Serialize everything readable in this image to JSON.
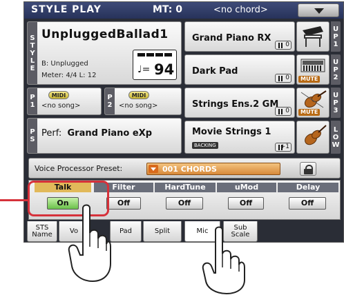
{
  "header": {
    "page_title": "STYLE PLAY",
    "mt": "MT: 0",
    "chord": "<no chord>"
  },
  "style": {
    "side_letters": [
      "S",
      "T",
      "Y",
      "L",
      "E"
    ],
    "name": "UnpluggedBallad1",
    "bank": "B: Unplugged",
    "meter": "Meter: 4/4  L: 12",
    "tempo_symbol": "♩=",
    "tempo": "94"
  },
  "song_players": [
    {
      "side": "P",
      "num": "1",
      "midi": "MIDI",
      "song": "<no song>"
    },
    {
      "side": "P",
      "num": "2",
      "midi": "MIDI",
      "song": "<no song>"
    }
  ],
  "performance": {
    "side": [
      "P",
      "S"
    ],
    "label": "Perf:",
    "name": "Grand Piano eXp"
  },
  "keyboard_sounds": [
    {
      "name": "Grand Piano RX",
      "vol": "0",
      "side": [
        "U",
        "P",
        "1"
      ],
      "icon": "piano-icon",
      "mute": ""
    },
    {
      "name": "Dark Pad",
      "vol": "0",
      "side": [
        "U",
        "P",
        "2"
      ],
      "icon": "synth-icon",
      "mute": "MUTE"
    },
    {
      "name": "Strings Ens.2 GM",
      "vol": "0",
      "side": [
        "U",
        "P",
        "3"
      ],
      "icon": "violin-icon",
      "mute": "MUTE"
    },
    {
      "name": "Movie Strings 1",
      "vol": "+1",
      "side": [
        "L",
        "O",
        "W"
      ],
      "icon": "violin-icon",
      "mute": "",
      "badge": "BACKING"
    }
  ],
  "voice_processor": {
    "label": "Voice Processor Preset:",
    "value": "001 CHORDS"
  },
  "effects": [
    {
      "title": "Talk",
      "value": "On"
    },
    {
      "title": "Filter",
      "value": "Off"
    },
    {
      "title": "HardTune",
      "value": "Off"
    },
    {
      "title": "uMod",
      "value": "Off"
    },
    {
      "title": "Delay",
      "value": "Off"
    }
  ],
  "tabs": [
    {
      "label": "STS Name"
    },
    {
      "label": "Vo"
    },
    {
      "label": "Pad"
    },
    {
      "label": "Split"
    },
    {
      "label": "Mic"
    },
    {
      "label": "Sub Scale"
    }
  ],
  "colors": {
    "accent_callout": "#d6313a",
    "dropdown": "#d8893a",
    "talk_on": "#6ac04a"
  }
}
